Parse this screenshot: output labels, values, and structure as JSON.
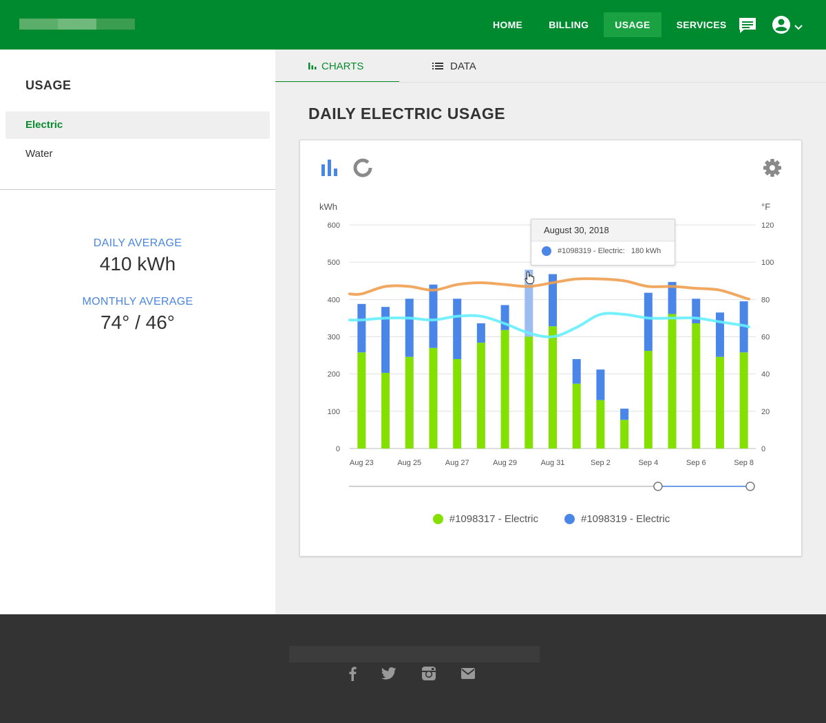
{
  "header": {
    "nav": [
      "HOME",
      "BILLING",
      "USAGE",
      "SERVICES"
    ],
    "active_nav": "USAGE",
    "icons": [
      "chat-icon",
      "account-icon",
      "chevron-down-icon"
    ]
  },
  "sidebar": {
    "title": "USAGE",
    "items": [
      "Electric",
      "Water"
    ],
    "active_item": "Electric",
    "daily_average_label": "DAILY AVERAGE",
    "daily_average_value": "410 kWh",
    "monthly_average_label": "MONTHLY AVERAGE",
    "monthly_average_value": "74° / 46°"
  },
  "tabs": [
    {
      "label": "CHARTS",
      "icon": "bar-chart-icon",
      "active": true
    },
    {
      "label": "DATA",
      "icon": "list-icon",
      "active": false
    }
  ],
  "page_title": "DAILY ELECTRIC USAGE",
  "card_icons": [
    "bar-chart-icon",
    "donut-chart-icon",
    "gear-icon"
  ],
  "tooltip": {
    "date": "August 30, 2018",
    "series": "#1098319 - Electric:",
    "value": "180 kWh"
  },
  "colors": {
    "brand_green": "#008a30",
    "series_1": "#84e000",
    "series_2": "#4a86e8",
    "high_temp": "#f0a050",
    "low_temp": "#66eeff"
  },
  "chart_data": {
    "type": "bar",
    "stacked": true,
    "categories": [
      "Aug 23",
      "Aug 24",
      "Aug 25",
      "Aug 26",
      "Aug 27",
      "Aug 28",
      "Aug 29",
      "Aug 30",
      "Aug 31",
      "Sep 1",
      "Sep 2",
      "Sep 3",
      "Sep 4",
      "Sep 5",
      "Sep 6",
      "Sep 7",
      "Sep 8"
    ],
    "x_tick_labels": [
      "Aug 23",
      "Aug 25",
      "Aug 27",
      "Aug 29",
      "Aug 31",
      "Sep 2",
      "Sep 4",
      "Sep 6",
      "Sep 8"
    ],
    "series": [
      {
        "name": "#1098317 - Electric",
        "values": [
          258,
          203,
          246,
          270,
          240,
          284,
          318,
          300,
          328,
          174,
          130,
          77,
          262,
          361,
          336,
          246,
          258
        ]
      },
      {
        "name": "#1098319 - Electric",
        "values": [
          130,
          177,
          156,
          170,
          162,
          52,
          67,
          180,
          140,
          66,
          82,
          30,
          156,
          86,
          66,
          119,
          137
        ]
      }
    ],
    "temperature_lines": [
      {
        "values": [
          83,
          87,
          87,
          85,
          88,
          89,
          88,
          87,
          89,
          91,
          91,
          90,
          87,
          87,
          86,
          85,
          81
        ]
      },
      {
        "values": [
          69,
          70,
          70,
          69,
          71,
          71,
          67,
          62,
          60,
          65,
          72,
          72,
          70,
          70,
          70,
          68,
          66
        ]
      }
    ],
    "ylabel": "kWh",
    "y2label": "°F",
    "ylim": [
      0,
      600
    ],
    "y2lim": [
      0,
      120
    ],
    "yticks": [
      0,
      100,
      200,
      300,
      400,
      500,
      600
    ],
    "y2ticks": [
      0,
      20,
      40,
      60,
      80,
      100,
      120
    ],
    "grid": true,
    "legend": "bottom",
    "highlighted_category": "Aug 30",
    "range_slider": {
      "start_fraction": 0.77,
      "end_fraction": 1.0
    }
  }
}
